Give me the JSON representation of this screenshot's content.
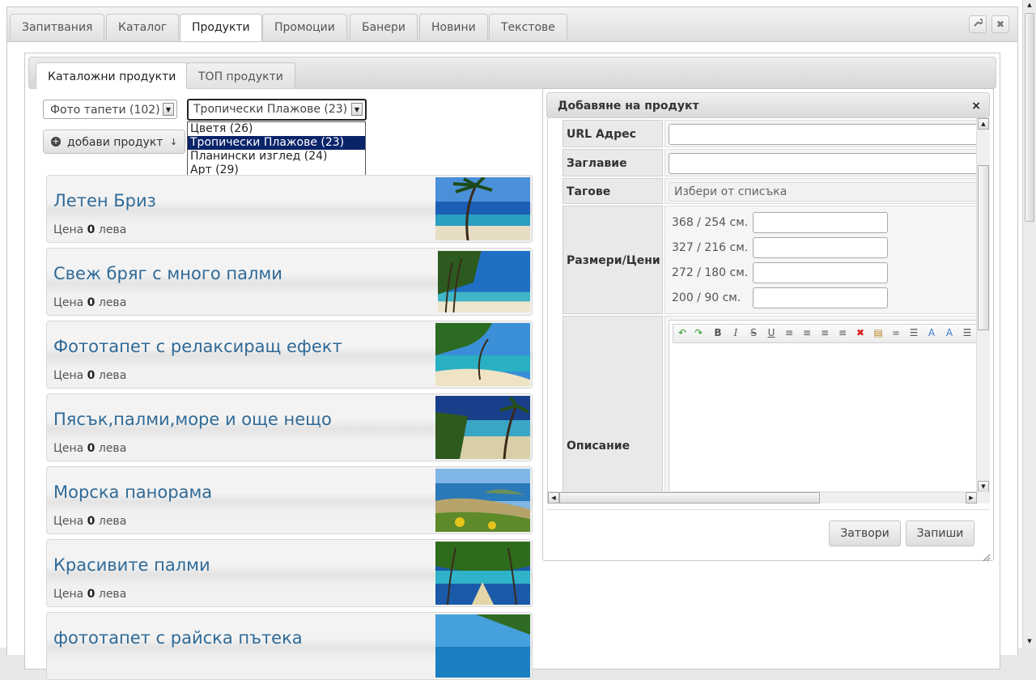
{
  "top_tabs": [
    "Запитвания",
    "Каталог",
    "Продукти",
    "Промоции",
    "Банери",
    "Новини",
    "Текстове"
  ],
  "active_top_tab": "Продукти",
  "sub_tabs": [
    "Каталожни продукти",
    "ТОП продукти"
  ],
  "filters": {
    "category_select": "Фото тапети (102)",
    "subcategory_select": "Тропически Плажове (23)",
    "subcategory_options": [
      "Цветя (26)",
      "Тропически Плажове (23)",
      "Планински изглед (24)",
      "Арт (29)"
    ],
    "selected_option": "Тропически Плажове (23)"
  },
  "add_button": "добави продукт",
  "products": [
    {
      "title": "Летен Бриз",
      "price_label": "Цена",
      "price": "0",
      "currency": "лева"
    },
    {
      "title": "Свеж бряг с много палми",
      "price_label": "Цена",
      "price": "0",
      "currency": "лева"
    },
    {
      "title": "Фототапет с релаксиращ ефект",
      "price_label": "Цена",
      "price": "0",
      "currency": "лева"
    },
    {
      "title": "Пясък,палми,море и още нещо",
      "price_label": "Цена",
      "price": "0",
      "currency": "лева"
    },
    {
      "title": "Морска панорама",
      "price_label": "Цена",
      "price": "0",
      "currency": "лева"
    },
    {
      "title": "Красивите палми",
      "price_label": "Цена",
      "price": "0",
      "currency": "лева"
    },
    {
      "title": "фототапет с райска пътека",
      "price_label": "",
      "price": "",
      "currency": ""
    }
  ],
  "dialog": {
    "title": "Добавяне на продукт",
    "close": "×",
    "fields": {
      "url_label": "URL Адрес",
      "title_label": "Заглавие",
      "tags_label": "Тагове",
      "tags_placeholder": "Избери от списъка",
      "sizes_label": "Размери/Цени",
      "sizes": [
        "368 / 254 см.",
        "327 / 216 см.",
        "272 / 180 см.",
        "200 / 90 см."
      ],
      "description_label": "Описание"
    },
    "buttons": {
      "close": "Затвори",
      "save": "Запиши"
    }
  },
  "colors": {
    "title_link": "#2f6a97",
    "selected_option_bg": "#0a246a"
  }
}
